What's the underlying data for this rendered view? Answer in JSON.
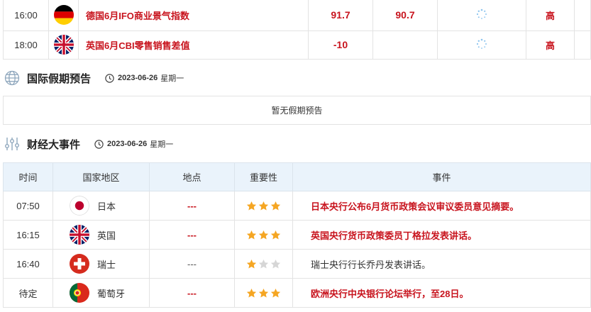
{
  "indicators": [
    {
      "time": "16:00",
      "country_flag": "germany-flag",
      "name": "德国6月IFO商业景气指数",
      "previous": "91.7",
      "forecast": "90.7",
      "importance": "高"
    },
    {
      "time": "18:00",
      "country_flag": "uk-flag",
      "name": "英国6月CBI零售销售差值",
      "previous": "-10",
      "forecast": "",
      "importance": "高"
    }
  ],
  "holiday_section": {
    "title": "国际假期预告",
    "date": "2023-06-26",
    "weekday": "星期一",
    "empty_text": "暂无假期预告",
    "icon": "globe-icon"
  },
  "events_section": {
    "title": "财经大事件",
    "date": "2023-06-26",
    "weekday": "星期一",
    "icon": "sliders-icon",
    "columns": [
      "时间",
      "国家地区",
      "地点",
      "重要性",
      "事件"
    ],
    "rows": [
      {
        "time": "07:50",
        "flag": "japan-flag",
        "country": "日本",
        "place": "---",
        "stars": 3,
        "event": "日本央行公布6月货币政策会议审议委员意见摘要。",
        "highlight": true
      },
      {
        "time": "16:15",
        "flag": "uk-flag",
        "country": "英国",
        "place": "---",
        "stars": 3,
        "event": "英国央行货币政策委员丁格拉发表讲话。",
        "highlight": true
      },
      {
        "time": "16:40",
        "flag": "switzerland-flag",
        "country": "瑞士",
        "place": "---",
        "stars": 1,
        "event": "瑞士央行行长乔丹发表讲话。",
        "highlight": false
      },
      {
        "time": "待定",
        "flag": "portugal-flag",
        "country": "葡萄牙",
        "place": "---",
        "stars": 3,
        "event": "欧洲央行中央银行论坛举行，至28日。",
        "highlight": true
      }
    ]
  },
  "colors": {
    "accent_red": "#c8141e",
    "star_gold": "#f5a623",
    "star_gray": "#d6d6d6",
    "header_bg": "#eaf3fb"
  }
}
